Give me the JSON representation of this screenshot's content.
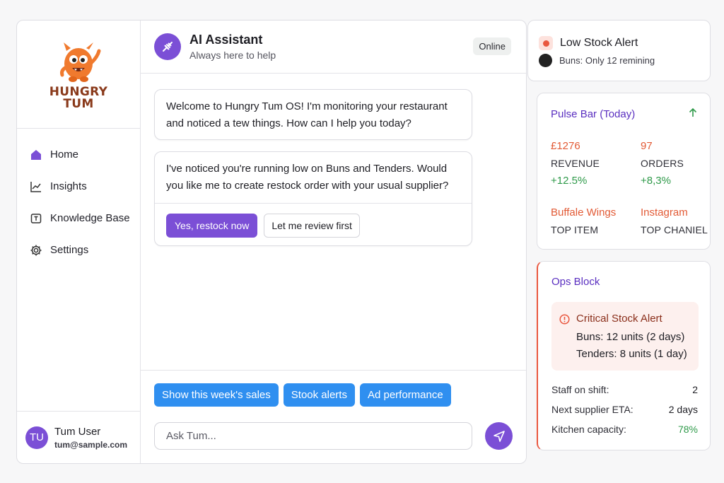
{
  "brand": {
    "logo_line1": "HUNGRY",
    "logo_line2": "TUM"
  },
  "sidebar": {
    "items": [
      {
        "label": "Home",
        "icon": "home-icon"
      },
      {
        "label": "Insights",
        "icon": "chart-line-icon"
      },
      {
        "label": "Knowledge Base",
        "icon": "book-icon"
      },
      {
        "label": "Settings",
        "icon": "gear-icon"
      }
    ]
  },
  "user": {
    "initials": "TU",
    "name": "Tum User",
    "email": "tum@sample.com"
  },
  "chat": {
    "title": "AI Assistant",
    "subtitle": "Always here to help",
    "status": "Online",
    "messages": [
      {
        "text": "Welcome to Hungry Tum OS! I'm monitoring your restaurant and noticed a tew things. How can I help you today?"
      },
      {
        "text": "I've noticed you're running low on Buns and Tenders. Would you like me to create restock order with your usual supplier?",
        "primary_action": "Yes, restock now",
        "secondary_action": "Let me review first"
      }
    ],
    "suggestions": [
      "Show this week's sales",
      "Stook alerts",
      "Ad performance"
    ],
    "input_placeholder": "Ask Tum..."
  },
  "low_stock": {
    "title": "Low Stock Alert",
    "detail": "Buns: Only 12 remining"
  },
  "pulse": {
    "title": "Pulse Bar (Today)",
    "revenue": {
      "value": "£1276",
      "label": "REVENUE",
      "delta": "+12.5%"
    },
    "orders": {
      "value": "97",
      "label": "ORDERS",
      "delta": "+8,3%"
    },
    "top_item": {
      "value": "Buffale Wings",
      "label": "TOP ITEM"
    },
    "top_channel": {
      "value": "Instagram",
      "label": "TOP CHANIEL"
    }
  },
  "ops": {
    "title": "Ops Block",
    "critical": {
      "title": "Critical Stock Alert",
      "lines": [
        "Buns: 12 units (2 days)",
        "Tenders: 8 units (1 day)"
      ]
    },
    "rows": [
      {
        "label": "Staff on shift:",
        "value": "2"
      },
      {
        "label": "Next supplier ETA:",
        "value": "2 days"
      },
      {
        "label": "Kitchen capacity:",
        "value": "78%"
      }
    ]
  },
  "colors": {
    "accent": "#7b4fd6",
    "chip": "#2f8ff0",
    "alert": "#e9573f",
    "positive": "#2f9a4a",
    "logo": "#f07a2e"
  }
}
